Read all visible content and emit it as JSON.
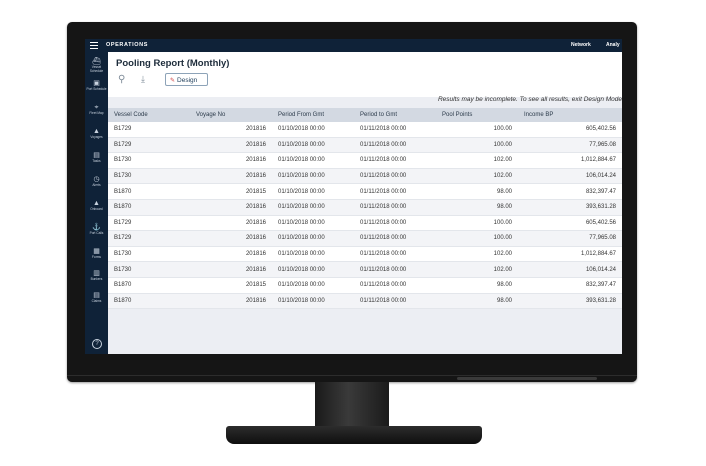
{
  "topbar": {
    "title": "OPERATIONS",
    "network": "Network",
    "analytics": "Analy"
  },
  "sidebar": {
    "items": [
      {
        "icon": "ship-icon",
        "glyph": "⛴",
        "label": "Vessel Schedule"
      },
      {
        "icon": "port-schedule-icon",
        "glyph": "▣",
        "label": "Port Schedule"
      },
      {
        "icon": "fleet-map-icon",
        "glyph": "⌖",
        "label": "Fleet Map"
      },
      {
        "icon": "voyages-icon",
        "glyph": "▲",
        "label": "Voyages"
      },
      {
        "icon": "tasks-icon",
        "glyph": "▤",
        "label": "Tasks"
      },
      {
        "icon": "alerts-icon",
        "glyph": "◷",
        "label": "Alerts"
      },
      {
        "icon": "onboard-icon",
        "glyph": "▲",
        "label": "Onboard"
      },
      {
        "icon": "port-calls-icon",
        "glyph": "⚓",
        "label": "Port Calls"
      },
      {
        "icon": "forms-icon",
        "glyph": "▦",
        "label": "Forms"
      },
      {
        "icon": "bunkers-icon",
        "glyph": "▥",
        "label": "Bunkers"
      },
      {
        "icon": "claims-icon",
        "glyph": "▤",
        "label": "Claims"
      }
    ],
    "help": "?"
  },
  "report": {
    "title": "Pooling Report (Monthly)",
    "design_label": "Design",
    "incomplete_msg": "Results may be incomplete. To see all results, exit Design Mode"
  },
  "table": {
    "columns": [
      "Vessel Code",
      "Voyage No",
      "Period From Gmt",
      "Period to Gmt",
      "Pool Points",
      "Income BP"
    ],
    "rows": [
      [
        "B1729",
        "201816",
        "01/10/2018 00:00",
        "01/11/2018 00:00",
        "100.00",
        "605,402.56"
      ],
      [
        "B1729",
        "201816",
        "01/10/2018 00:00",
        "01/11/2018 00:00",
        "100.00",
        "77,965.08"
      ],
      [
        "B1730",
        "201816",
        "01/10/2018 00:00",
        "01/11/2018 00:00",
        "102.00",
        "1,012,884.67"
      ],
      [
        "B1730",
        "201816",
        "01/10/2018 00:00",
        "01/11/2018 00:00",
        "102.00",
        "106,014.24"
      ],
      [
        "B1870",
        "201815",
        "01/10/2018 00:00",
        "01/11/2018 00:00",
        "98.00",
        "832,397.47"
      ],
      [
        "B1870",
        "201816",
        "01/10/2018 00:00",
        "01/11/2018 00:00",
        "98.00",
        "393,631.28"
      ],
      [
        "B1729",
        "201816",
        "01/10/2018 00:00",
        "01/11/2018 00:00",
        "100.00",
        "605,402.56"
      ],
      [
        "B1729",
        "201816",
        "01/10/2018 00:00",
        "01/11/2018 00:00",
        "100.00",
        "77,965.08"
      ],
      [
        "B1730",
        "201816",
        "01/10/2018 00:00",
        "01/11/2018 00:00",
        "102.00",
        "1,012,884.67"
      ],
      [
        "B1730",
        "201816",
        "01/10/2018 00:00",
        "01/11/2018 00:00",
        "102.00",
        "106,014.24"
      ],
      [
        "B1870",
        "201815",
        "01/10/2018 00:00",
        "01/11/2018 00:00",
        "98.00",
        "832,397.47"
      ],
      [
        "B1870",
        "201816",
        "01/10/2018 00:00",
        "01/11/2018 00:00",
        "98.00",
        "393,631.28"
      ]
    ]
  }
}
